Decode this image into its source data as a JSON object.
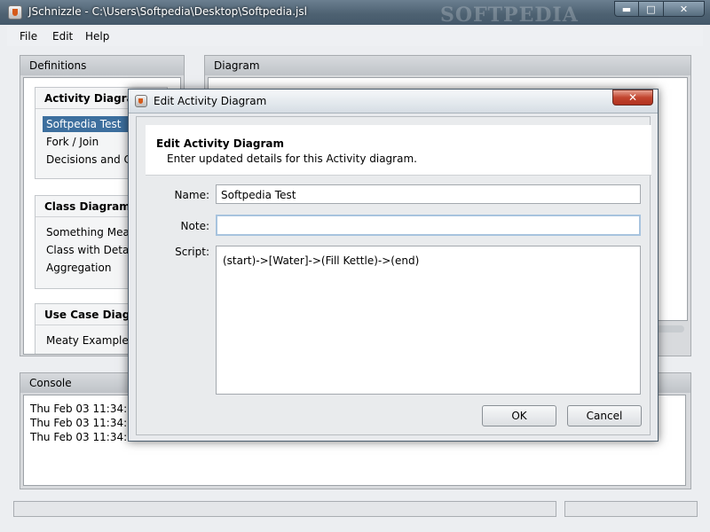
{
  "window": {
    "title": "JSchnizzle - C:\\Users\\Softpedia\\Desktop\\Softpedia.jsl",
    "watermark": "SOFTPEDIA",
    "minimize": "▬",
    "maximize": "□",
    "close": "✕"
  },
  "menu": [
    "File",
    "Edit",
    "Help"
  ],
  "definitions": {
    "title": "Definitions",
    "groups": [
      {
        "title": "Activity Diagrams",
        "items": [
          "Softpedia Test",
          "Fork / Join",
          "Decisions and C"
        ]
      },
      {
        "title": "Class Diagrams",
        "items": [
          "Something Meaty",
          "Class with Detai",
          "Aggregation"
        ]
      },
      {
        "title": "Use Case Diagra...",
        "items": [
          "Meaty Example"
        ]
      }
    ]
  },
  "diagram": {
    "title": "Diagram"
  },
  "console": {
    "title": "Console",
    "lines": [
      "Thu Feb 03 11:34:11",
      "Thu Feb 03 11:34:21",
      "Thu Feb 03 11:34:54"
    ]
  },
  "dialog": {
    "title": "Edit Activity Diagram",
    "heading": "Edit Activity Diagram",
    "subheading": "Enter updated details for this Activity diagram.",
    "name_label": "Name:",
    "name_value": "Softpedia Test",
    "note_label": "Note:",
    "note_value": "",
    "script_label": "Script:",
    "script_value": "(start)->[Water]->(Fill Kettle)->(end)",
    "ok_label": "OK",
    "cancel_label": "Cancel",
    "close": "✕"
  }
}
